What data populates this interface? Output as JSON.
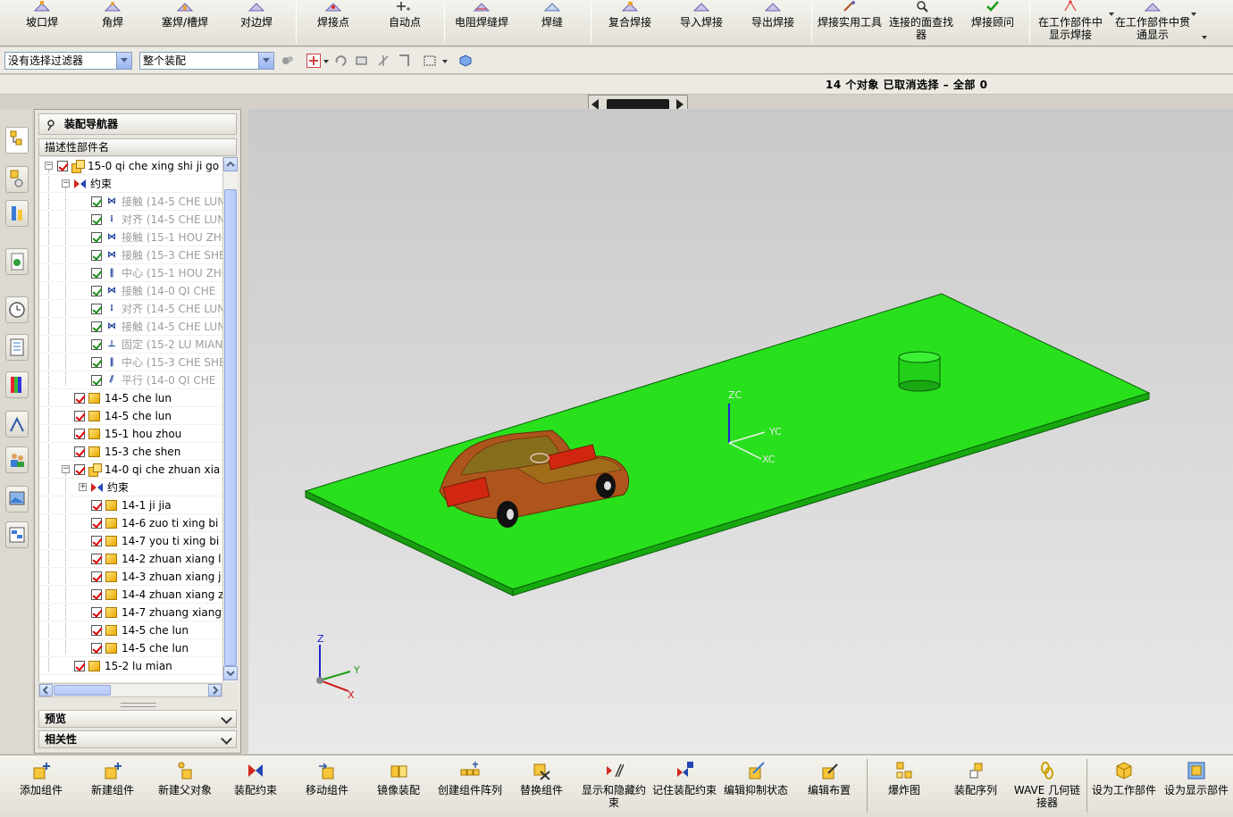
{
  "top_toolbar": {
    "buttons": [
      {
        "label": "坡口焊",
        "icon": "groove-weld-icon"
      },
      {
        "label": "角焊",
        "icon": "fillet-weld-icon"
      },
      {
        "label": "塞焊/槽焊",
        "icon": "plug-slot-weld-icon"
      },
      {
        "label": "对边焊",
        "icon": "edge-weld-icon"
      },
      {
        "label": "焊接点",
        "icon": "weld-point-icon"
      },
      {
        "label": "自动点",
        "icon": "auto-point-icon"
      },
      {
        "label": "电阻焊缝焊",
        "icon": "resistance-seam-weld-icon"
      },
      {
        "label": "焊缝",
        "icon": "weld-bead-icon"
      },
      {
        "label": "复合焊接",
        "icon": "combined-weld-icon"
      },
      {
        "label": "导入焊接",
        "icon": "import-weld-icon"
      },
      {
        "label": "导出焊接",
        "icon": "export-weld-icon"
      },
      {
        "label": "焊接实用工具",
        "icon": "weld-utilities-icon"
      },
      {
        "label": "连接的面查找器",
        "icon": "connected-face-finder-icon"
      },
      {
        "label": "焊接顾问",
        "icon": "weld-assistant-icon"
      },
      {
        "label": "在工作部件中显示焊接",
        "icon": "show-welds-in-work-part-icon"
      },
      {
        "label": "在工作部件中贯通显示",
        "icon": "show-through-work-part-icon"
      }
    ]
  },
  "filter_toolbar": {
    "selection_filter": "没有选择过滤器",
    "scope": "整个装配"
  },
  "status": {
    "text": "14 个对象 已取消选择  – 全部 0"
  },
  "navigator": {
    "title": "装配导航器",
    "column_header": "描述性部件名",
    "rows": [
      {
        "indent": 0,
        "expander": "−",
        "check": "red",
        "icon": "assembly",
        "label": "15-0 qi che xing shi ji go",
        "dim": false
      },
      {
        "indent": 1,
        "expander": "−",
        "check": "none",
        "icon": "constraints",
        "label": "约束",
        "dim": false
      },
      {
        "indent": 2,
        "expander": "",
        "check": "green",
        "icon": "touch",
        "label": "接触 (14-5 CHE LUN",
        "dim": true
      },
      {
        "indent": 2,
        "expander": "",
        "check": "green",
        "icon": "align",
        "label": "对齐 (14-5 CHE LUN",
        "dim": true
      },
      {
        "indent": 2,
        "expander": "",
        "check": "green",
        "icon": "touch",
        "label": "接触 (15-1 HOU ZHO",
        "dim": true
      },
      {
        "indent": 2,
        "expander": "",
        "check": "green",
        "icon": "touch",
        "label": "接触 (15-3 CHE SHE",
        "dim": true
      },
      {
        "indent": 2,
        "expander": "",
        "check": "green",
        "icon": "center",
        "label": "中心 (15-1 HOU ZHO",
        "dim": true
      },
      {
        "indent": 2,
        "expander": "",
        "check": "green",
        "icon": "touch",
        "label": "接触 (14-0  QI CHE",
        "dim": true
      },
      {
        "indent": 2,
        "expander": "",
        "check": "green",
        "icon": "align",
        "label": "对齐 (14-5 CHE LUN",
        "dim": true
      },
      {
        "indent": 2,
        "expander": "",
        "check": "green",
        "icon": "touch",
        "label": "接触 (14-5 CHE LUN",
        "dim": true
      },
      {
        "indent": 2,
        "expander": "",
        "check": "green",
        "icon": "fix",
        "label": "固定 (15-2 LU MIAN",
        "dim": true
      },
      {
        "indent": 2,
        "expander": "",
        "check": "green",
        "icon": "center",
        "label": "中心 (15-3 CHE SHE",
        "dim": true
      },
      {
        "indent": 2,
        "expander": "",
        "check": "green",
        "icon": "parallel",
        "label": "平行 (14-0  QI CHE",
        "dim": true
      },
      {
        "indent": 1,
        "expander": "",
        "check": "red",
        "icon": "part",
        "label": "14-5 che lun",
        "dim": false
      },
      {
        "indent": 1,
        "expander": "",
        "check": "red",
        "icon": "part",
        "label": "14-5 che lun",
        "dim": false
      },
      {
        "indent": 1,
        "expander": "",
        "check": "red",
        "icon": "part",
        "label": "15-1 hou zhou",
        "dim": false
      },
      {
        "indent": 1,
        "expander": "",
        "check": "red",
        "icon": "part",
        "label": "15-3 che shen",
        "dim": false
      },
      {
        "indent": 1,
        "expander": "−",
        "check": "red",
        "icon": "assembly",
        "label": "14-0  qi che zhuan xia",
        "dim": false
      },
      {
        "indent": 2,
        "expander": "+",
        "check": "none",
        "icon": "constraints",
        "label": "约束",
        "dim": false
      },
      {
        "indent": 2,
        "expander": "",
        "check": "red",
        "icon": "part",
        "label": "14-1 ji jia",
        "dim": false
      },
      {
        "indent": 2,
        "expander": "",
        "check": "red",
        "icon": "part",
        "label": "14-6 zuo ti xing bi",
        "dim": false
      },
      {
        "indent": 2,
        "expander": "",
        "check": "red",
        "icon": "part",
        "label": "14-7 you ti xing bi",
        "dim": false
      },
      {
        "indent": 2,
        "expander": "",
        "check": "red",
        "icon": "part",
        "label": "14-2 zhuan xiang l",
        "dim": false
      },
      {
        "indent": 2,
        "expander": "",
        "check": "red",
        "icon": "part",
        "label": "14-3 zhuan xiang j",
        "dim": false
      },
      {
        "indent": 2,
        "expander": "",
        "check": "red",
        "icon": "part",
        "label": "14-4 zhuan xiang z",
        "dim": false
      },
      {
        "indent": 2,
        "expander": "",
        "check": "red",
        "icon": "part",
        "label": "14-7 zhuang xiang",
        "dim": false
      },
      {
        "indent": 2,
        "expander": "",
        "check": "red",
        "icon": "part",
        "label": "14-5 che lun",
        "dim": false
      },
      {
        "indent": 2,
        "expander": "",
        "check": "red",
        "icon": "part",
        "label": "14-5 che lun",
        "dim": false
      },
      {
        "indent": 1,
        "expander": "",
        "check": "red",
        "icon": "part",
        "label": "15-2 lu mian",
        "dim": false
      }
    ],
    "preview_label": "预览",
    "dependencies_label": "相关性"
  },
  "viewport": {
    "wcs_labels": {
      "z": "ZC",
      "y": "YC",
      "x": "XC"
    },
    "abs_labels": {
      "z": "Z",
      "y": "Y",
      "x": "X"
    },
    "colors": {
      "ground": "#22e019",
      "car_body": "#c0381a",
      "cylinder": "#1fd81a"
    }
  },
  "bottom_toolbar": {
    "buttons": [
      {
        "label": "添加组件",
        "icon": "add-component-icon"
      },
      {
        "label": "新建组件",
        "icon": "new-component-icon"
      },
      {
        "label": "新建父对象",
        "icon": "new-parent-icon"
      },
      {
        "label": "装配约束",
        "icon": "assembly-constraints-icon"
      },
      {
        "label": "移动组件",
        "icon": "move-component-icon"
      },
      {
        "label": "镜像装配",
        "icon": "mirror-assembly-icon"
      },
      {
        "label": "创建组件阵列",
        "icon": "component-array-icon"
      },
      {
        "label": "替换组件",
        "icon": "replace-component-icon"
      },
      {
        "label": "显示和隐藏约束",
        "icon": "show-hide-constraints-icon"
      },
      {
        "label": "记住装配约束",
        "icon": "remember-constraints-icon"
      },
      {
        "label": "编辑抑制状态",
        "icon": "edit-suppression-icon"
      },
      {
        "label": "编辑布置",
        "icon": "edit-arrangements-icon"
      },
      {
        "label": "爆炸图",
        "icon": "exploded-view-icon"
      },
      {
        "label": "装配序列",
        "icon": "assembly-sequence-icon"
      },
      {
        "label": "WAVE 几何链接器",
        "icon": "wave-geometry-linker-icon"
      },
      {
        "label": "设为工作部件",
        "icon": "make-work-part-icon"
      },
      {
        "label": "设为显示部件",
        "icon": "make-displayed-part-icon"
      }
    ]
  }
}
